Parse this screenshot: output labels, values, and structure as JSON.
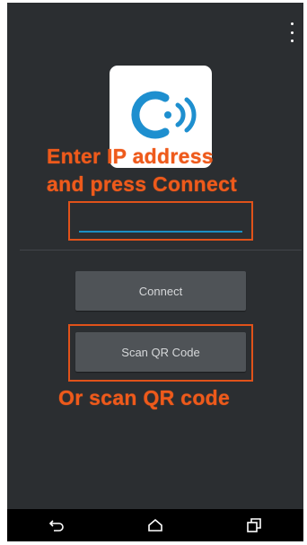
{
  "annotations": {
    "ip_line1": "Enter IP address",
    "ip_line2": "and press Connect",
    "scan": "Or scan QR code"
  },
  "form": {
    "ip_value": "",
    "connect_label": "Connect",
    "scan_label": "Scan QR Code"
  },
  "icons": {
    "overflow": "overflow-menu-icon",
    "logo": "app-logo",
    "back": "back-icon",
    "home": "home-icon",
    "recents": "recents-icon"
  },
  "colors": {
    "background": "#2b2e31",
    "annotation": "#ee5a1b",
    "input_underline": "#1b8fc2",
    "button": "#4f5357",
    "logo_blue": "#1e8fcf"
  }
}
